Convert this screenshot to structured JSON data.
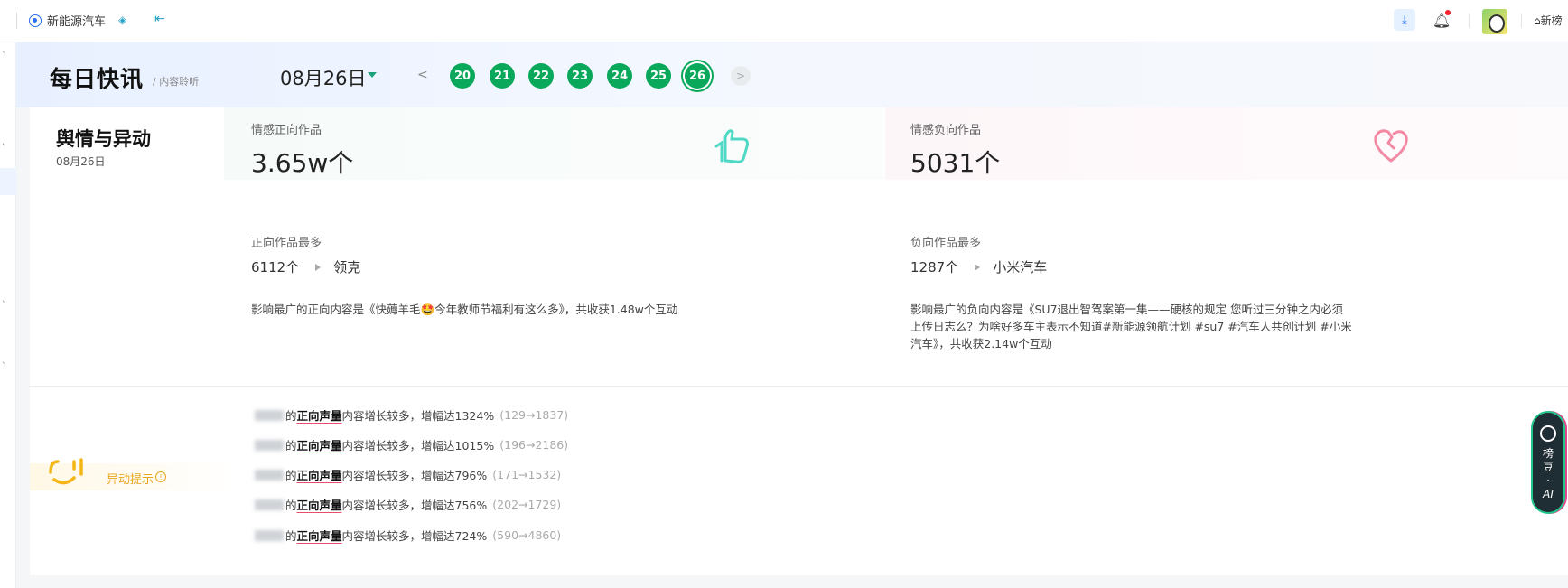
{
  "topbar": {
    "brand": "新能源汽车",
    "home_label": "⌂新榜",
    "icons": [
      "target-icon",
      "switch-icon",
      "collapse-icon",
      "download-icon",
      "bell-icon",
      "avatar"
    ]
  },
  "header": {
    "title": "每日快讯",
    "subtitle": "/ 内容聆听",
    "date_selected": "08月26日",
    "days": [
      "20",
      "21",
      "22",
      "23",
      "24",
      "25",
      "26"
    ],
    "active_day": "26"
  },
  "section": {
    "title": "舆情与异动",
    "date": "08月26日"
  },
  "positive": {
    "label": "情感正向作品",
    "count": "3.65w个",
    "top_label": "正向作品最多",
    "top_count": "6112个",
    "top_brand": "领克",
    "desc": "影响最广的正向内容是《快薅羊毛🤩今年教师节福利有这么多》，共收获1.48w个互动"
  },
  "negative": {
    "label": "情感负向作品",
    "count": "5031个",
    "top_label": "负向作品最多",
    "top_count": "1287个",
    "top_brand": "小米汽车",
    "desc_line1": "影响最广的负向内容是《SU7退出智驾案第一集——硬核的规定 您听过三分钟之内必须",
    "desc_line2": "上传日志么？为啥好多车主表示不知道#新能源领航计划 #su7 #汽车人共创计划 #小米",
    "desc_line3": "汽车》，共收获2.14w个互动"
  },
  "anomaly": {
    "label": "异动提示",
    "rows": [
      {
        "prefix": "的",
        "keyword": "正向声量",
        "text": "内容增长较多，增幅达1324%",
        "range": "(129→1837)"
      },
      {
        "prefix": "的",
        "keyword": "正向声量",
        "text": "内容增长较多，增幅达1015%",
        "range": "(196→2186)"
      },
      {
        "prefix": "的",
        "keyword": "正向声量",
        "text": "内容增长较多，增幅达796%",
        "range": "(171→1532)"
      },
      {
        "prefix": "的",
        "keyword": "正向声量",
        "text": "内容增长较多，增幅达756%",
        "range": "(202→1729)"
      },
      {
        "prefix": "的",
        "keyword": "正向声量",
        "text": "内容增长较多，增幅达724%",
        "range": "(590→4860)"
      }
    ]
  },
  "ai_button": {
    "line1": "榜",
    "line2": "豆",
    "line3": "·",
    "line4": "AI"
  },
  "colors": {
    "accent_green": "#0aa85a",
    "accent_blue": "#2d6cf6",
    "warning": "#e8a51a",
    "highlight_underline": "#e54d6b"
  }
}
